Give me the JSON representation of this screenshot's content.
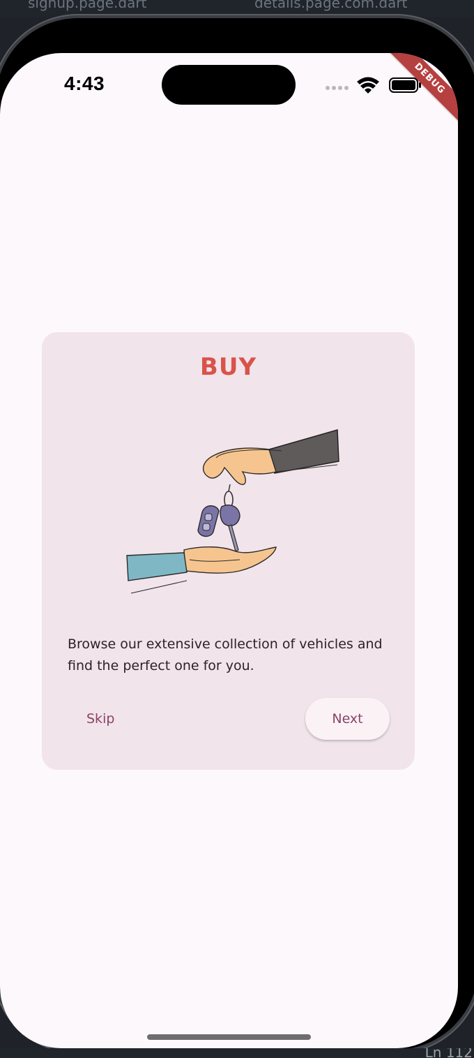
{
  "editor": {
    "tab_left": "signup.page.dart",
    "tab_right": "details.page.com.dart",
    "footer_text": "Ln 112"
  },
  "status_bar": {
    "time": "4:43",
    "debug_label": "DEBUG",
    "icons": [
      "signal-dots-icon",
      "wifi-icon",
      "battery-icon"
    ]
  },
  "onboarding": {
    "title": "BUY",
    "description": "Browse our extensive collection of vehicles and find the perfect one for you.",
    "skip_label": "Skip",
    "next_label": "Next",
    "illustration": "hands-car-keys-illustration"
  },
  "colors": {
    "screen_background": "#fdf8fc",
    "card_background": "#f1e4ea",
    "title_color": "#d9534a",
    "button_text": "#8a4366",
    "debug_banner": "#b5403f"
  }
}
